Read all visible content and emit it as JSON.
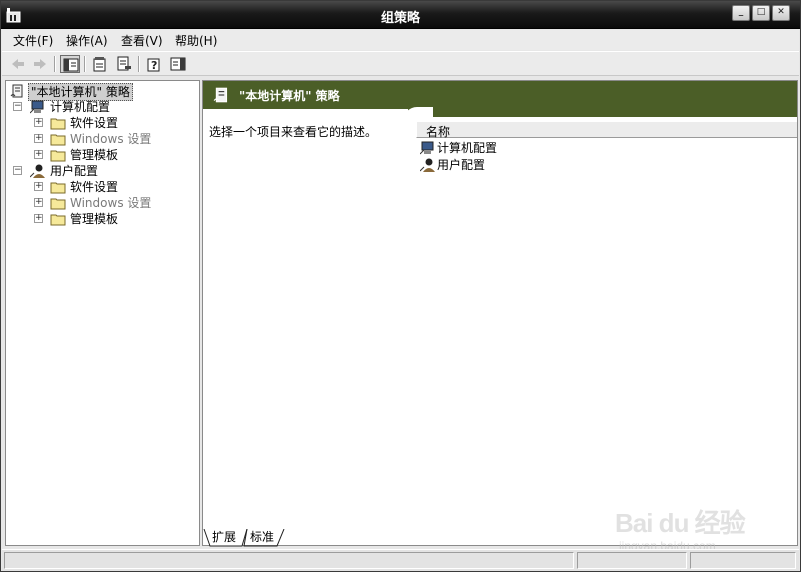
{
  "window": {
    "title": "组策略",
    "minimize_glyph": "_",
    "maximize_glyph": "□",
    "close_glyph": "✕"
  },
  "menubar": {
    "items": [
      {
        "label": "文件(F)"
      },
      {
        "label": "操作(A)"
      },
      {
        "label": "查看(V)"
      },
      {
        "label": "帮助(H)"
      }
    ]
  },
  "toolbar": {
    "buttons": [
      {
        "icon": "back-arrow-icon",
        "enabled": false
      },
      {
        "icon": "forward-arrow-icon",
        "enabled": false
      },
      {
        "icon": "show-hide-tree-icon",
        "pressed": true
      },
      {
        "icon": "properties-icon"
      },
      {
        "icon": "export-list-icon"
      },
      {
        "icon": "help-icon"
      },
      {
        "icon": "show-hide-action-pane-icon"
      }
    ]
  },
  "tree": {
    "root": {
      "label": "\"本地计算机\" 策略",
      "icon": "policy-scroll-icon",
      "selected": true
    },
    "nodes": [
      {
        "label": "计算机配置",
        "icon": "computer-config-icon",
        "expanded": true,
        "children": [
          {
            "label": "软件设置",
            "icon": "folder-icon"
          },
          {
            "label": "Windows 设置",
            "icon": "folder-icon"
          },
          {
            "label": "管理模板",
            "icon": "folder-icon"
          }
        ]
      },
      {
        "label": "用户配置",
        "icon": "user-config-icon",
        "expanded": true,
        "children": [
          {
            "label": "软件设置",
            "icon": "folder-icon"
          },
          {
            "label": "Windows 设置",
            "icon": "folder-icon"
          },
          {
            "label": "管理模板",
            "icon": "folder-icon"
          }
        ]
      }
    ]
  },
  "details": {
    "header_title": "\"本地计算机\" 策略",
    "description": "选择一个项目来查看它的描述。",
    "column_name": "名称",
    "items": [
      {
        "label": "计算机配置",
        "icon": "computer-config-icon"
      },
      {
        "label": "用户配置",
        "icon": "user-config-icon"
      }
    ]
  },
  "tabs": [
    {
      "label": "扩展",
      "active": true
    },
    {
      "label": "标准",
      "active": false
    }
  ],
  "watermark": {
    "logo_text": "Bai du 经验",
    "sub_text": "jingyan.baidu.com"
  },
  "colors": {
    "header_green": "#4b5e27",
    "titlebar": "#1a1a1a",
    "selection": "#cfcfcf"
  }
}
